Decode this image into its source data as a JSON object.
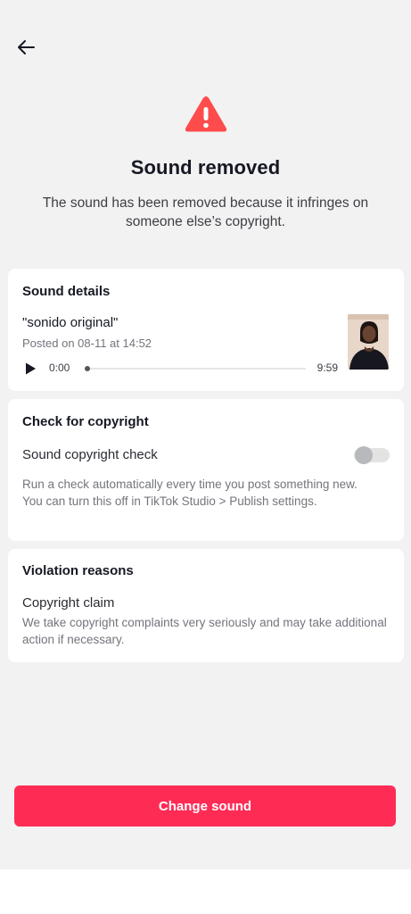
{
  "header": {
    "back_icon": "arrow-left-icon"
  },
  "status": {
    "icon": "warning-triangle-icon",
    "icon_color": "#fe4b4b",
    "title": "Sound removed",
    "subtitle": "The sound has been removed because it infringes on someone else’s copyright."
  },
  "sound_details": {
    "heading": "Sound details",
    "name": "\"sonido original\"",
    "posted": "Posted on 08-11 at 14:52",
    "time_current": "0:00",
    "time_total": "9:59",
    "progress": 0,
    "play_icon": "play-icon"
  },
  "copyright_check": {
    "heading": "Check for copyright",
    "label": "Sound copyright check",
    "enabled": false,
    "description": "Run a check automatically every time you post something new. You can turn this off in TikTok Studio > Publish settings."
  },
  "violation": {
    "heading": "Violation reasons",
    "title": "Copyright claim",
    "description": "We take copyright complaints very seriously and may take additional action if necessary."
  },
  "actions": {
    "change_sound": "Change sound",
    "accent_color": "#fe2c55"
  }
}
